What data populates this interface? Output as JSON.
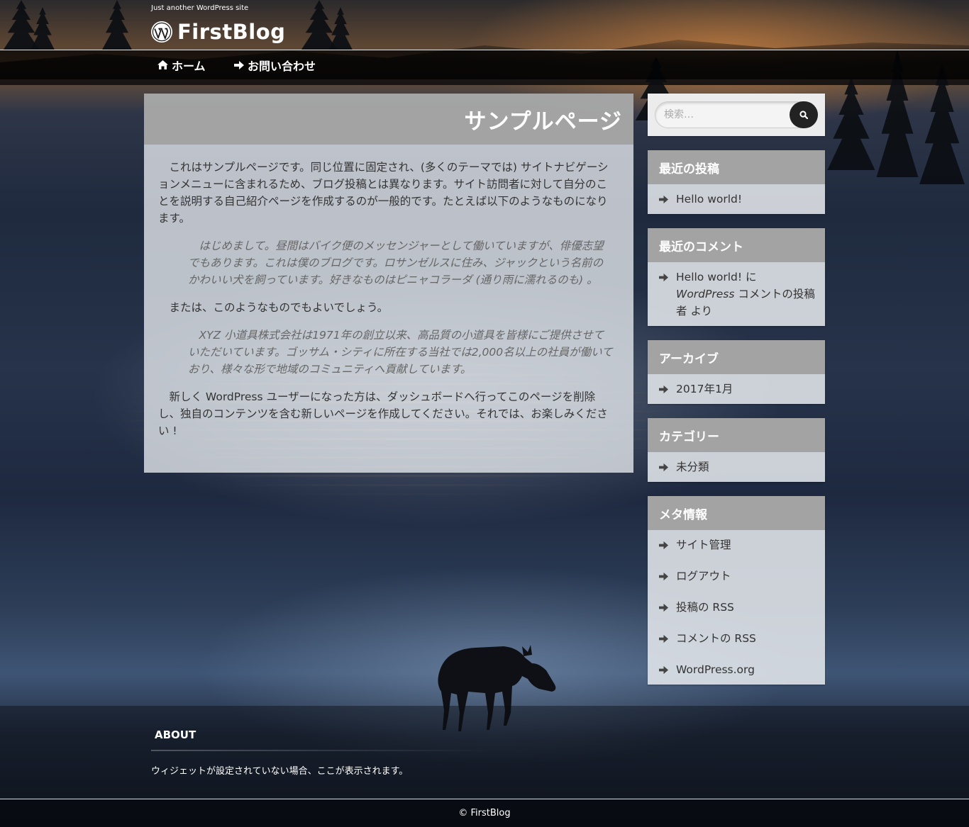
{
  "site": {
    "tagline": "Just another WordPress site",
    "title": "FirstBlog"
  },
  "nav": {
    "home": "ホーム",
    "contact": "お問い合わせ"
  },
  "page": {
    "title": "サンプルページ",
    "paragraphs": [
      "これはサンプルページです。同じ位置に固定され、(多くのテーマでは) サイトナビゲーションメニューに含まれるため、ブログ投稿とは異なります。サイト訪問者に対して自分のことを説明する自己紹介ページを作成するのが一般的です。たとえば以下のようなものになります。",
      "はじめまして。昼間はバイク便のメッセンジャーとして働いていますが、俳優志望でもあります。これは僕のブログです。ロサンゼルスに住み、ジャックという名前のかわいい犬を飼っています。好きなものはピニャコラーダ (通り雨に濡れるのも) 。",
      "または、このようなものでもよいでしょう。",
      "XYZ 小道具株式会社は1971年の創立以来、高品質の小道具を皆様にご提供させていただいています。ゴッサム・シティに所在する当社では2,000名以上の社員が働いており、様々な形で地域のコミュニティへ貢献しています。",
      "新しく WordPress ユーザーになった方は、ダッシュボードへ行ってこのページを削除し、独自のコンテンツを含む新しいページを作成してください。それでは、お楽しみください !"
    ]
  },
  "search": {
    "placeholder": "検索…"
  },
  "widgets": {
    "recent_posts": {
      "title": "最近の投稿",
      "items": [
        "Hello world!"
      ]
    },
    "recent_comments": {
      "title": "最近のコメント",
      "post": "Hello world!",
      "on": " に ",
      "author": "WordPress",
      "author_suffix": " コメントの投稿者",
      "by": " より"
    },
    "archives": {
      "title": "アーカイブ",
      "items": [
        "2017年1月"
      ]
    },
    "categories": {
      "title": "カテゴリー",
      "items": [
        "未分類"
      ]
    },
    "meta": {
      "title": "メタ情報",
      "items": [
        "サイト管理",
        "ログアウト",
        "投稿の RSS",
        "コメントの RSS",
        "WordPress.org"
      ]
    }
  },
  "footer": {
    "about_title": "ABOUT",
    "about_text": "ウィジェットが設定されていない場合、ここが表示されます。",
    "copyright": "© FirstBlog"
  },
  "colors": {
    "widget_header": "#a0a0a0",
    "panel_bg": "#e4e7ec",
    "nav_bg": "#000000",
    "search_button": "#222222"
  },
  "icons": {
    "logo": "wordpress-logo-icon",
    "home": "home-icon",
    "contact": "arrow-right-icon",
    "search": "search-icon",
    "list": "arrow-right-icon"
  }
}
